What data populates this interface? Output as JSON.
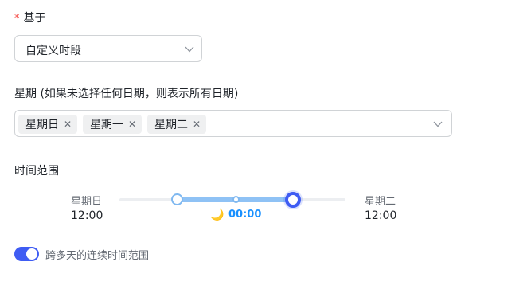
{
  "based_on": {
    "required_mark": "*",
    "label": "基于",
    "selected": "自定义时段"
  },
  "weekdays": {
    "label": "星期 (如果未选择任何日期，则表示所有日期)",
    "tags": [
      "星期日",
      "星期一",
      "星期二"
    ]
  },
  "time_range": {
    "label": "时间范围",
    "start": {
      "day": "星期日",
      "time": "12:00"
    },
    "end": {
      "day": "星期二",
      "time": "12:00"
    },
    "midpoint_time": "00:00",
    "midpoint_icon": "moon-icon"
  },
  "continuous": {
    "enabled": true,
    "label": "跨多天的连续时间范围"
  },
  "colors": {
    "accent": "#3f5cf3",
    "range_fill": "#8fc2f5",
    "midpoint_text": "#1890ff",
    "required": "#f54a45"
  }
}
